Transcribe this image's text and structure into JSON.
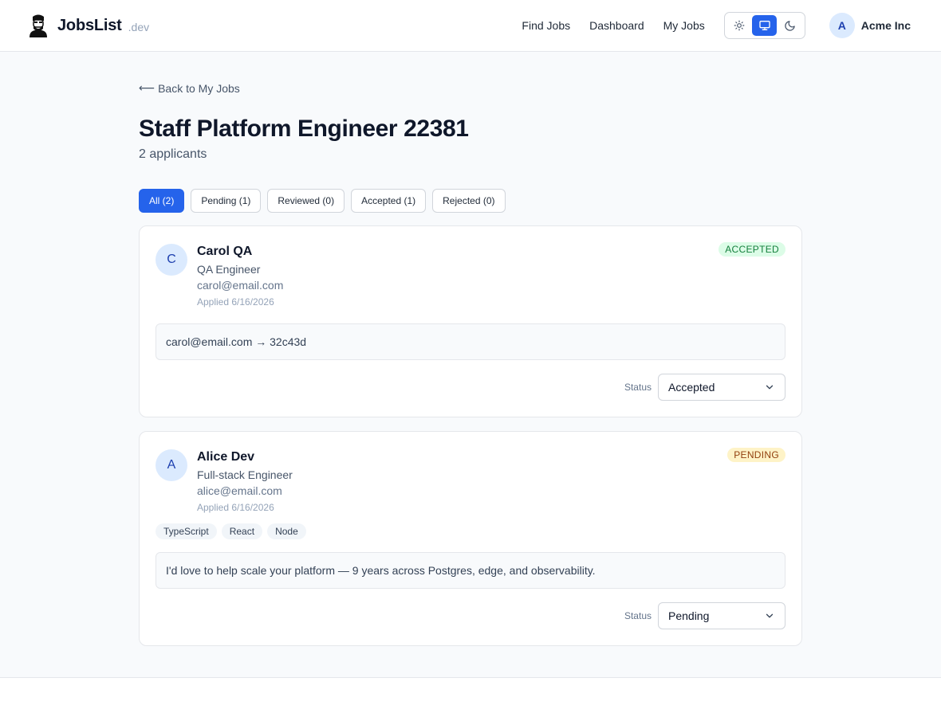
{
  "header": {
    "brand_name": "JobsList",
    "brand_suffix": ".dev",
    "nav": [
      "Find Jobs",
      "Dashboard",
      "My Jobs"
    ],
    "theme_modes": [
      "light",
      "system",
      "dark"
    ],
    "theme_active": "system",
    "account": {
      "initial": "A",
      "name": "Acme Inc"
    }
  },
  "page": {
    "back_label": "Back to My Jobs",
    "title": "Staff Platform Engineer 22381",
    "subtitle": "2 applicants"
  },
  "filters": [
    {
      "label": "All (2)",
      "active": true
    },
    {
      "label": "Pending (1)",
      "active": false
    },
    {
      "label": "Reviewed (0)",
      "active": false
    },
    {
      "label": "Accepted (1)",
      "active": false
    },
    {
      "label": "Rejected (0)",
      "active": false
    }
  ],
  "applicants": [
    {
      "initial": "C",
      "name": "Carol QA",
      "role": "QA Engineer",
      "email": "carol@email.com",
      "applied": "Applied 6/16/2026",
      "badge": "ACCEPTED",
      "tags": [],
      "note": "carol@email.com → 32c43d",
      "status_label": "Status",
      "status_value": "Accepted"
    },
    {
      "initial": "A",
      "name": "Alice Dev",
      "role": "Full-stack Engineer",
      "email": "alice@email.com",
      "applied": "Applied 6/16/2026",
      "badge": "PENDING",
      "tags": [
        "TypeScript",
        "React",
        "Node"
      ],
      "note": "I'd love to help scale your platform — 9 years across Postgres, edge, and observability.",
      "status_label": "Status",
      "status_value": "Pending"
    }
  ],
  "colors": {
    "accent": "#2563eb",
    "accepted_bg": "#dcfce7",
    "accepted_fg": "#15803d",
    "pending_bg": "#fef3c7",
    "pending_fg": "#92400e"
  }
}
